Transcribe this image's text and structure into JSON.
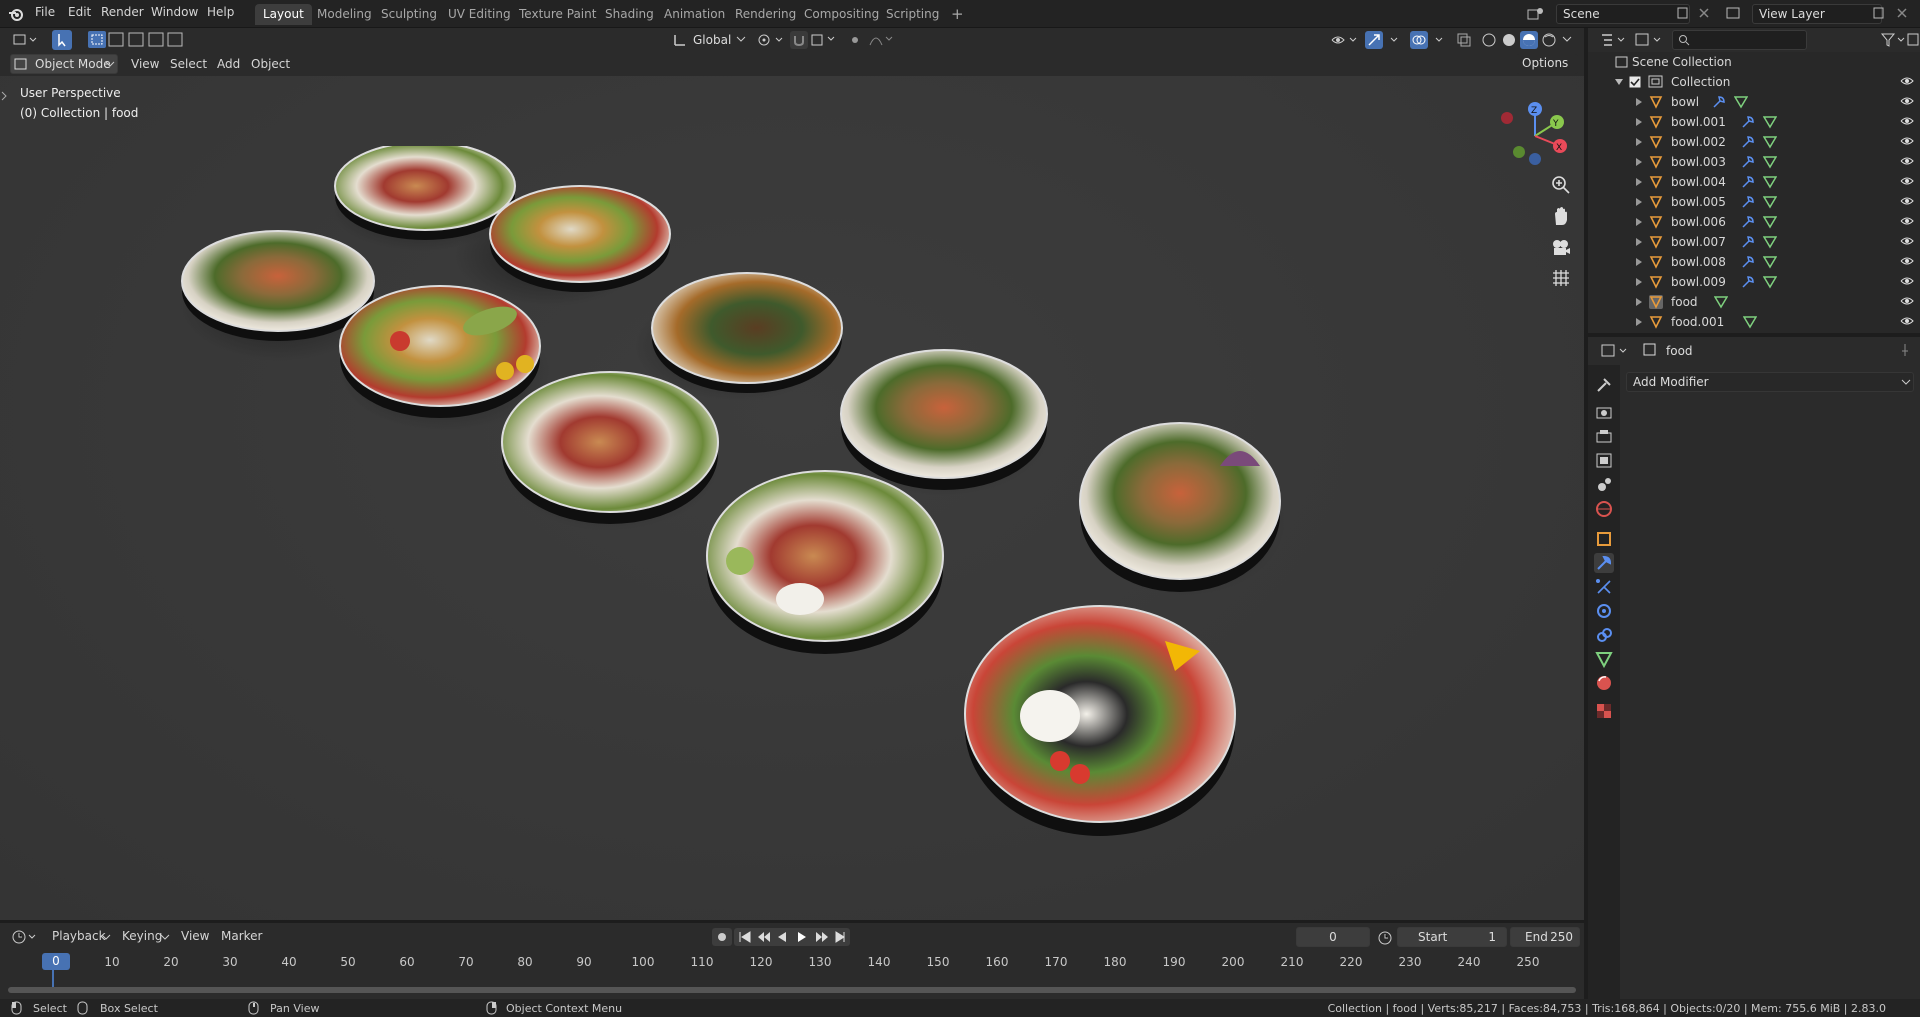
{
  "topbar": {
    "menus": [
      "File",
      "Edit",
      "Render",
      "Window",
      "Help"
    ],
    "workspaces": [
      "Layout",
      "Modeling",
      "Sculpting",
      "UV Editing",
      "Texture Paint",
      "Shading",
      "Animation",
      "Rendering",
      "Compositing",
      "Scripting"
    ],
    "active_workspace": "Layout",
    "add_tab": "+",
    "scene": "Scene",
    "view_layer": "View Layer"
  },
  "viewport_header": {
    "mode": "Object Mode",
    "menus": [
      "View",
      "Select",
      "Add",
      "Object"
    ],
    "orientation": "Global",
    "options": "Options"
  },
  "viewport": {
    "perspective": "User Perspective",
    "collection_info": "(0) Collection | food",
    "gizmo": {
      "x": "X",
      "y": "Y",
      "z": "Z"
    }
  },
  "outliner": {
    "root": "Scene Collection",
    "collection": "Collection",
    "items": [
      "bowl",
      "bowl.001",
      "bowl.002",
      "bowl.003",
      "bowl.004",
      "bowl.005",
      "bowl.006",
      "bowl.007",
      "bowl.008",
      "bowl.009",
      "food",
      "food.001"
    ]
  },
  "properties": {
    "object_name": "food",
    "add_modifier": "Add Modifier"
  },
  "timeline": {
    "menus": [
      "Playback",
      "Keying",
      "View",
      "Marker"
    ],
    "current_frame": "0",
    "start_label": "Start",
    "start": "1",
    "end_label": "End",
    "end": "250",
    "ticks": [
      "0",
      "10",
      "20",
      "30",
      "40",
      "50",
      "60",
      "70",
      "80",
      "90",
      "100",
      "110",
      "120",
      "130",
      "140",
      "150",
      "160",
      "170",
      "180",
      "190",
      "200",
      "210",
      "220",
      "230",
      "240",
      "250"
    ]
  },
  "statusbar": {
    "select": "Select",
    "box_select": "Box Select",
    "pan_view": "Pan View",
    "context_menu": "Object Context Menu",
    "stats": "Collection | food | Verts:85,217 | Faces:84,753 | Tris:168,864 | Objects:0/20 | Mem: 755.6 MiB | 2.83.0"
  },
  "colors": {
    "accent": "#4772b3",
    "bg": "#393939",
    "object_orange": "#e89b3b",
    "mesh_green": "#7ed07e"
  }
}
